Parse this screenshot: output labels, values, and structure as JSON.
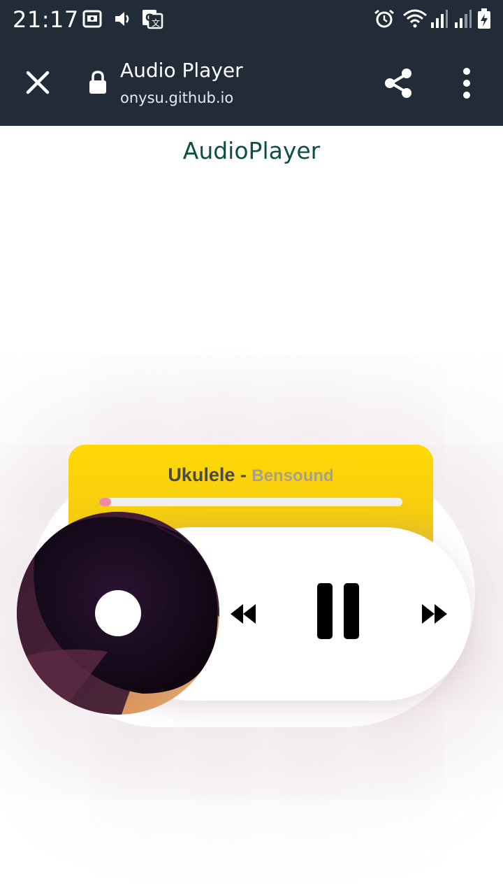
{
  "status_bar": {
    "time": "21:17",
    "left_icons": [
      "screen-record-icon",
      "volume-icon",
      "translate-icon"
    ],
    "right_icons": [
      "alarm-icon",
      "wifi-icon",
      "signal-icon",
      "signal-icon",
      "battery-charging-icon"
    ]
  },
  "browser": {
    "title": "Audio Player",
    "url": "onysu.github.io",
    "icons": [
      "close-icon",
      "lock-icon",
      "share-icon",
      "more-vert-icon"
    ]
  },
  "page": {
    "heading": "AudioPlayer"
  },
  "player": {
    "track_title": "Ukulele",
    "separator": " - ",
    "artist": "Bensound",
    "progress": 0.04,
    "state": "playing",
    "controls": [
      "rewind-icon",
      "pause-icon",
      "fast-forward-icon"
    ],
    "colors": {
      "card": "#ffd905",
      "progress_fill": "#f08aa0",
      "progress_track": "#efefef",
      "heading": "#0d4f45",
      "toolbar": "#222b38"
    }
  }
}
